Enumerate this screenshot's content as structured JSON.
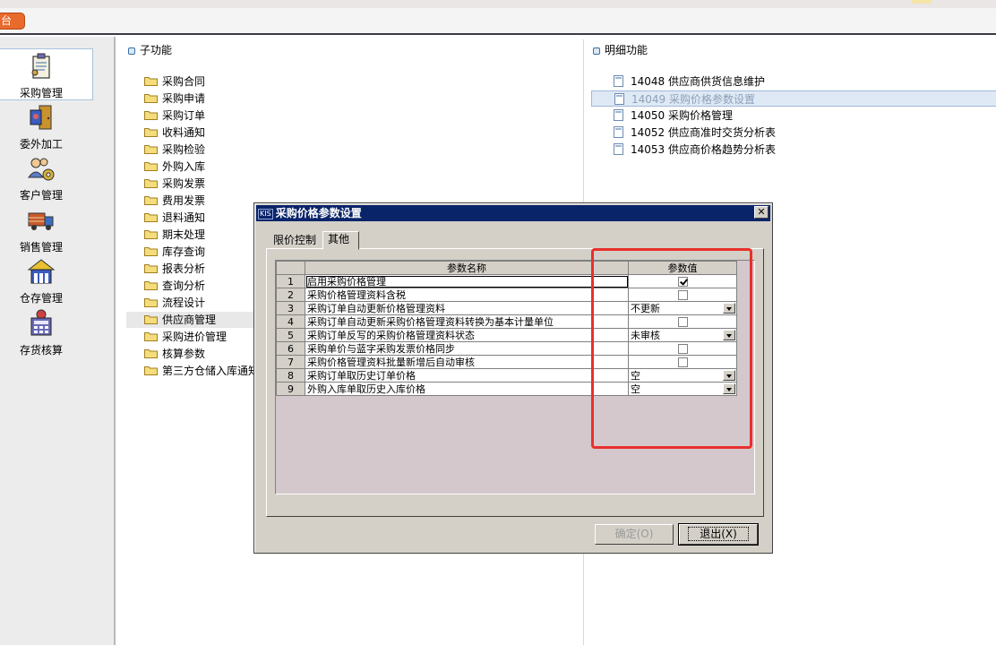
{
  "top_tab": {
    "label": "台"
  },
  "left_nav": [
    {
      "label": "采购管理",
      "icon": "purchase-clipboard-icon",
      "active": true
    },
    {
      "label": "委外加工",
      "icon": "outsourcing-door-icon",
      "active": false
    },
    {
      "label": "客户管理",
      "icon": "customer-gear-icon",
      "active": false
    },
    {
      "label": "销售管理",
      "icon": "delivery-truck-icon",
      "active": false
    },
    {
      "label": "仓存管理",
      "icon": "warehouse-icon",
      "active": false
    },
    {
      "label": "存货核算",
      "icon": "calculator-icon",
      "active": false
    }
  ],
  "sub_functions": {
    "header": "子功能",
    "items": [
      "采购合同",
      "采购申请",
      "采购订单",
      "收料通知",
      "采购检验",
      "外购入库",
      "采购发票",
      "费用发票",
      "退料通知",
      "期末处理",
      "库存查询",
      "报表分析",
      "查询分析",
      "流程设计",
      "供应商管理",
      "采购进价管理",
      "核算参数",
      "第三方仓储入库通知"
    ],
    "selected_index": 14
  },
  "detail_functions": {
    "header": "明细功能",
    "items": [
      {
        "code": "14048",
        "label": "供应商供货信息维护"
      },
      {
        "code": "14049",
        "label": "采购价格参数设置"
      },
      {
        "code": "14050",
        "label": "采购价格管理"
      },
      {
        "code": "14052",
        "label": "供应商准时交货分析表"
      },
      {
        "code": "14053",
        "label": "供应商价格趋势分析表"
      }
    ],
    "selected_index": 1
  },
  "dialog": {
    "logo": "KIS",
    "title": "采购价格参数设置",
    "tabs": [
      "限价控制",
      "其他"
    ],
    "active_tab": 1,
    "columns": [
      "参数名称",
      "参数值"
    ],
    "rows": [
      {
        "no": "1",
        "name": "启用采购价格管理",
        "type": "checkbox",
        "checked": true
      },
      {
        "no": "2",
        "name": "采购价格管理资料含税",
        "type": "checkbox",
        "checked": false
      },
      {
        "no": "3",
        "name": "采购订单自动更新价格管理资料",
        "type": "dropdown",
        "value": "不更新"
      },
      {
        "no": "4",
        "name": "采购订单自动更新采购价格管理资料转换为基本计量单位",
        "type": "checkbox",
        "checked": false
      },
      {
        "no": "5",
        "name": "采购订单反写的采购价格管理资料状态",
        "type": "dropdown",
        "value": "未审核"
      },
      {
        "no": "6",
        "name": "采购单价与蓝字采购发票价格同步",
        "type": "checkbox",
        "checked": false
      },
      {
        "no": "7",
        "name": "采购价格管理资料批量新增后自动审核",
        "type": "checkbox",
        "checked": false
      },
      {
        "no": "8",
        "name": "采购订单取历史订单价格",
        "type": "dropdown",
        "value": "空"
      },
      {
        "no": "9",
        "name": "外购入库单取历史入库价格",
        "type": "dropdown",
        "value": "空"
      }
    ],
    "ok_label": "确定(O)",
    "exit_label": "退出(X)"
  },
  "colors": {
    "title_bar": "#0a246a",
    "highlight_box": "#e8302c",
    "tab_button": "#e86a2c"
  }
}
